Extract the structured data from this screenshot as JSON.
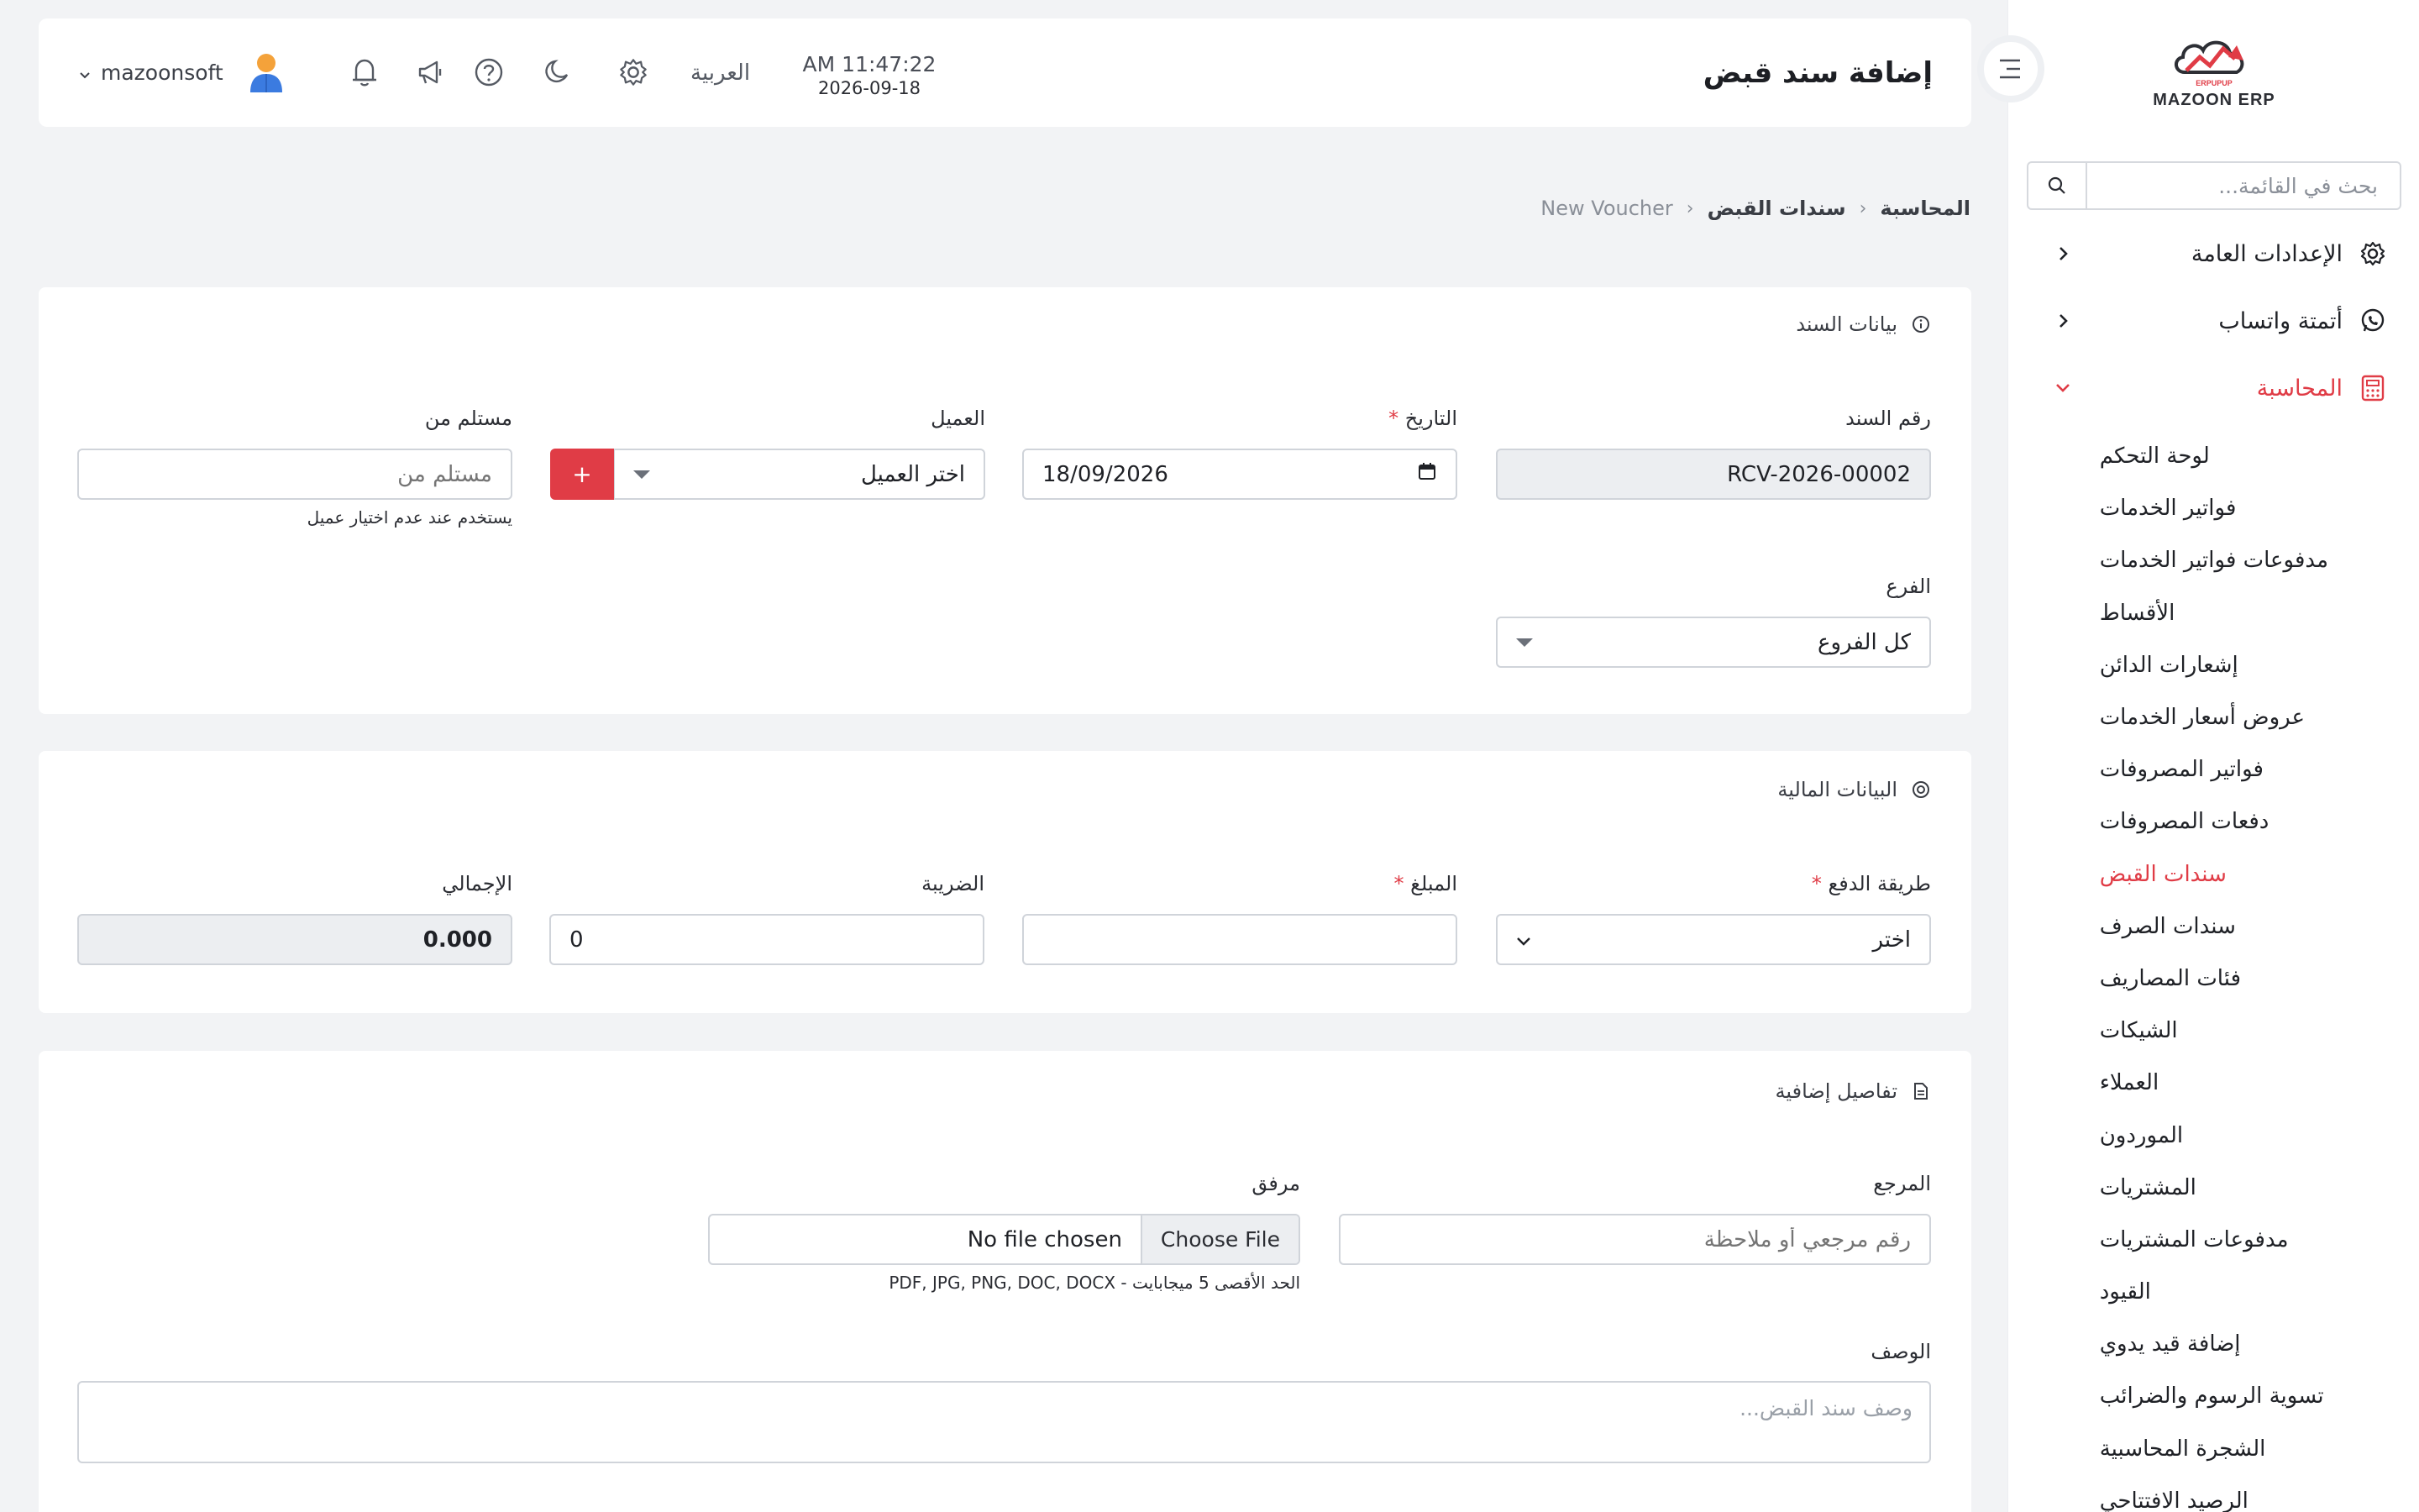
{
  "sidebar": {
    "logo_text": "MAZOON ERP",
    "search_placeholder": "بحث في القائمة...",
    "groups": [
      {
        "label": "الإعدادات العامة"
      },
      {
        "label": "أتمتة واتساب"
      },
      {
        "label": "المحاسبة"
      }
    ],
    "items": [
      {
        "label": "لوحة التحكم"
      },
      {
        "label": "فواتير الخدمات"
      },
      {
        "label": "مدفوعات فواتير الخدمات"
      },
      {
        "label": "الأقساط"
      },
      {
        "label": "إشعارات الدائن"
      },
      {
        "label": "عروض أسعار الخدمات"
      },
      {
        "label": "فواتير المصروفات"
      },
      {
        "label": "دفعات المصروفات"
      },
      {
        "label": "سندات القبض"
      },
      {
        "label": "سندات الصرف"
      },
      {
        "label": "فئات المصاريف"
      },
      {
        "label": "الشيكات"
      },
      {
        "label": "العملاء"
      },
      {
        "label": "الموردون"
      },
      {
        "label": "المشتريات"
      },
      {
        "label": "مدفوعات المشتريات"
      },
      {
        "label": "القيود"
      },
      {
        "label": "إضافة قيد يدوي"
      },
      {
        "label": "تسوية الرسوم والضرائب"
      },
      {
        "label": "الشجرة المحاسبية"
      },
      {
        "label": "الرصيد الافتتاحي"
      }
    ],
    "active_item": "سندات القبض"
  },
  "header": {
    "title": "إضافة سند قبض",
    "time": "AM 11:47:22",
    "date": "2026-09-18",
    "language": "العربية",
    "username": "mazoonsoft"
  },
  "breadcrumb": {
    "root": "المحاسبة",
    "section": "سندات القبض",
    "current": "New Voucher"
  },
  "voucher_section": {
    "title": "بيانات السند",
    "voucher_no_label": "رقم السند",
    "voucher_no_value": "RCV-2026-00002",
    "date_label": "التاريخ",
    "date_value": "18/09/2026",
    "customer_label": "العميل",
    "customer_value": "اختر العميل",
    "add_customer": "+",
    "received_from_label": "مستلم من",
    "received_from_placeholder": "مستلم من",
    "received_from_help": "يستخدم عند عدم اختيار عميل",
    "branch_label": "الفرع",
    "branch_value": "كل الفروع"
  },
  "financial_section": {
    "title": "البيانات المالية",
    "payment_method_label": "طريقة الدفع",
    "payment_method_value": "اختر",
    "amount_label": "المبلغ",
    "amount_value": "",
    "tax_label": "الضريبة",
    "tax_value": "0",
    "total_label": "الإجمالي",
    "total_value": "0.000"
  },
  "extra_section": {
    "title": "تفاصيل إضافية",
    "reference_label": "المرجع",
    "reference_placeholder": "رقم مرجعي أو ملاحظة",
    "attachment_label": "مرفق",
    "choose_file": "Choose File",
    "no_file": "No file chosen",
    "attachment_help": "PDF, JPG, PNG, DOC, DOCX - الحد الأقصى 5 ميجابايت",
    "description_label": "الوصف",
    "description_placeholder": "وصف سند القبض..."
  },
  "colors": {
    "accent": "#e03c46",
    "background": "#f2f3f5",
    "card": "#ffffff"
  }
}
